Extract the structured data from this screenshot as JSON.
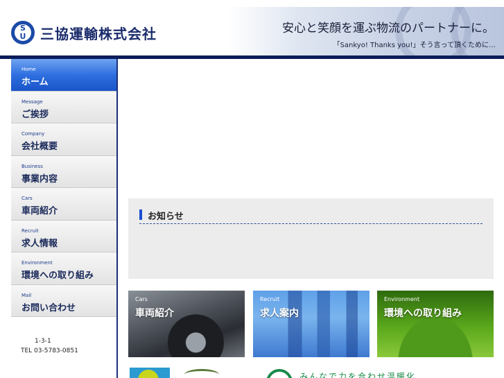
{
  "header": {
    "logo_letters": [
      "S",
      "U"
    ],
    "company_name": "三協運輸株式会社",
    "banner_title": "安心と笑顔を運ぶ物流のパートナーに。",
    "banner_subtitle": "「Sankyo! Thanks you!」そう言って頂くために…"
  },
  "sidebar": {
    "items": [
      {
        "en": "Home",
        "jp": "ホーム",
        "active": true
      },
      {
        "en": "Message",
        "jp": "ご挨拶",
        "active": false
      },
      {
        "en": "Company",
        "jp": "会社概要",
        "active": false
      },
      {
        "en": "Business",
        "jp": "事業内容",
        "active": false
      },
      {
        "en": "Cars",
        "jp": "車両紹介",
        "active": false
      },
      {
        "en": "Recruit",
        "jp": "求人情報",
        "active": false
      },
      {
        "en": "Environment",
        "jp": "環境への取り組み",
        "active": false
      },
      {
        "en": "Mail",
        "jp": "お問い合わせ",
        "active": false
      }
    ],
    "address_line": "1-3-1",
    "tel": "TEL 03-5783-0851"
  },
  "news": {
    "title": "お知らせ"
  },
  "tiles": [
    {
      "en": "Cars",
      "jp": "車両紹介"
    },
    {
      "en": "Recruit",
      "jp": "求人案内"
    },
    {
      "en": "Environment",
      "jp": "環境への取り組み"
    }
  ],
  "bottom_text": "みんなで力を合わせ温暖化",
  "colors": {
    "navy": "#0b1c5a",
    "accent_blue": "#2f6fe0",
    "news_bg": "#ececec",
    "text_dark": "#1a2a5a"
  }
}
